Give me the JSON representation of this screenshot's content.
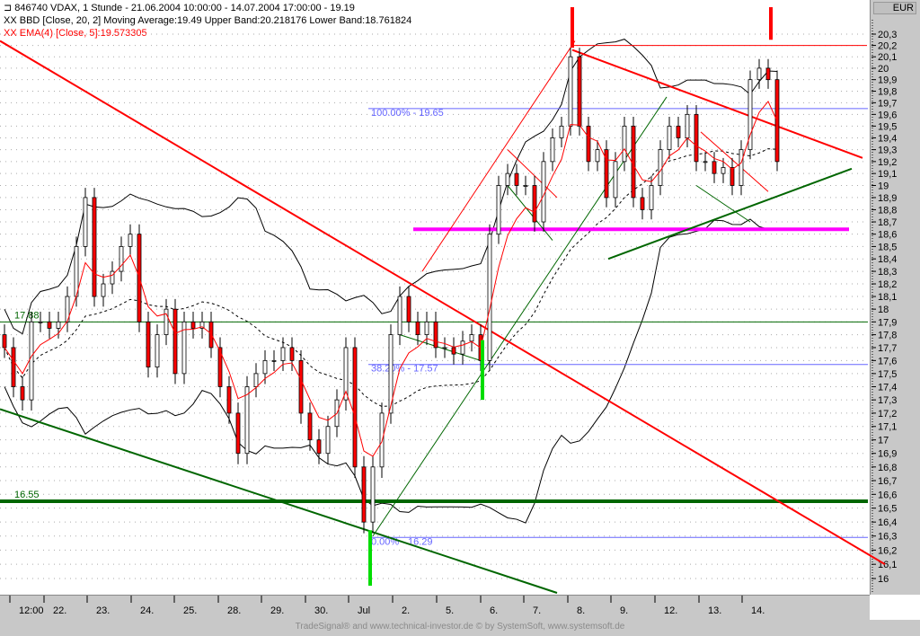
{
  "header": {
    "line1": "846740  VDAX, 1 Stunde - 21.06.2004 10:00:00 - 14.07.2004 17:00:00 - 19.19",
    "line2": "BBD [Close, 20, 2] Moving Average:19.49 Upper Band:20.218176 Lower Band:18.761824",
    "line3": "EMA(4) [Close, 5]:19.573305",
    "prefix": "XX"
  },
  "currency": "EUR",
  "footer": "TradeSignal® and www.technical-investor.de © by SystemSoft, www.systemsoft.de",
  "colors": {
    "up": "#ffffff",
    "down": "#ff0000",
    "ema": "#ff0000",
    "bands": "#000000",
    "magenta": "#ff00ff",
    "fib": "#6666ff",
    "green": "#006600",
    "marker_green": "#00dd00"
  },
  "chart_data": {
    "type": "candlestick",
    "y_scale": "log",
    "ylim": [
      16,
      20.3
    ],
    "y_ticks": [
      "16",
      "16,1",
      "16,2",
      "16,3",
      "16,4",
      "16,5",
      "16,6",
      "16,7",
      "16,8",
      "16,9",
      "17",
      "17,1",
      "17,2",
      "17,3",
      "17,4",
      "17,5",
      "17,6",
      "17,7",
      "17,8",
      "17,9",
      "18",
      "18,1",
      "18,2",
      "18,3",
      "18,4",
      "18,5",
      "18,6",
      "18,7",
      "18,8",
      "18,9",
      "19",
      "19,1",
      "19,2",
      "19,3",
      "19,4",
      "19,5",
      "19,6",
      "19,7",
      "19,8",
      "19,9",
      "20",
      "20,1",
      "20,2",
      "20,3"
    ],
    "x_labels": [
      {
        "label": "12:00",
        "bar": 0.9
      },
      {
        "label": "22.",
        "bar": 4.7
      },
      {
        "label": "23.",
        "bar": 9.5
      },
      {
        "label": "24.",
        "bar": 14.4
      },
      {
        "label": "25.",
        "bar": 19.2
      },
      {
        "label": "28.",
        "bar": 24.1
      },
      {
        "label": "29.",
        "bar": 28.9
      },
      {
        "label": "30.",
        "bar": 33.8
      },
      {
        "label": "Jul",
        "bar": 38.6
      },
      {
        "label": "2.",
        "bar": 43.5
      },
      {
        "label": "5.",
        "bar": 48.4
      },
      {
        "label": "6.",
        "bar": 53.3
      },
      {
        "label": "7.",
        "bar": 58.1
      },
      {
        "label": "8.",
        "bar": 63
      },
      {
        "label": "9.",
        "bar": 67.8
      },
      {
        "label": "12.",
        "bar": 72.7
      },
      {
        "label": "13.",
        "bar": 77.6
      },
      {
        "label": "14.",
        "bar": 82.4
      }
    ],
    "close": [
      17.7,
      17.4,
      17.3,
      17.9,
      17.9,
      17.85,
      17.9,
      18.1,
      18.5,
      18.9,
      18.1,
      18.2,
      18.3,
      18.5,
      18.6,
      17.9,
      17.55,
      17.8,
      18.0,
      17.5,
      17.9,
      17.85,
      17.9,
      17.7,
      17.4,
      17.2,
      16.9,
      17.4,
      17.5,
      17.6,
      17.6,
      17.7,
      17.6,
      17.2,
      17.0,
      16.9,
      17.1,
      17.3,
      17.7,
      16.8,
      16.4,
      16.8,
      17.2,
      17.8,
      18.1,
      17.9,
      17.8,
      17.9,
      17.7,
      17.7,
      17.65,
      17.75,
      17.8,
      17.6,
      18.6,
      19.0,
      19.1,
      19.0,
      19.0,
      18.7,
      19.2,
      19.4,
      19.5,
      20.1,
      19.5,
      19.2,
      19.3,
      18.9,
      19.2,
      19.5,
      18.9,
      18.8,
      19.0,
      19.3,
      19.5,
      19.4,
      19.6,
      19.2,
      19.2,
      19.1,
      19.15,
      19.0,
      19.3,
      19.9,
      20.0,
      19.9,
      19.2
    ],
    "indicators": [
      {
        "name": "BBD",
        "source": "Close",
        "period": 20,
        "deviations": 2,
        "moving_average": 19.49,
        "upper_band": 20.218176,
        "lower_band": 18.761824
      },
      {
        "name": "EMA(4)",
        "source": "Close",
        "period": 5,
        "value": 19.573305
      }
    ],
    "horizontal_levels": [
      {
        "label": "17.88",
        "price": 17.9,
        "color": "#006600",
        "width": 1
      },
      {
        "label": "16.55",
        "price": 16.55,
        "color": "#006600",
        "width": 4
      },
      {
        "label": "100.00% - 19.65",
        "price": 19.65,
        "color": "#6666ff",
        "width": 1,
        "from_bar": 40.5
      },
      {
        "label": "38.20% - 17.57",
        "price": 17.57,
        "color": "#6666ff",
        "width": 1,
        "from_bar": 40.5
      },
      {
        "label": "0.00% - 16.29",
        "price": 16.29,
        "color": "#6666ff",
        "width": 1,
        "from_bar": 40.5
      }
    ],
    "trend_lines": [
      {
        "from": [
          -0.5,
          20.24
        ],
        "to": [
          98,
          16.1
        ],
        "color": "#ff0000",
        "width": 2
      },
      {
        "from": [
          -0.5,
          17.23
        ],
        "to": [
          61.5,
          15.9
        ],
        "color": "#006600",
        "width": 2
      },
      {
        "from": [
          45.5,
          18.64
        ],
        "to": [
          94,
          18.64
        ],
        "color": "#ff00ff",
        "width": 4
      },
      {
        "from": [
          63.2,
          20.2
        ],
        "to": [
          96,
          20.2
        ],
        "color": "#ff0000",
        "width": 1
      },
      {
        "from": [
          63.2,
          20.16
        ],
        "to": [
          95.5,
          19.23
        ],
        "color": "#ff0000",
        "width": 2
      },
      {
        "from": [
          67.2,
          18.4
        ],
        "to": [
          94.3,
          19.14
        ],
        "color": "#006600",
        "width": 2
      },
      {
        "from": [
          46.5,
          18.3
        ],
        "to": [
          63.5,
          20.24
        ],
        "color": "#ff0000",
        "width": 1
      },
      {
        "from": [
          41,
          16.3
        ],
        "to": [
          73.7,
          19.75
        ],
        "color": "#006600",
        "width": 1
      },
      {
        "from": [
          56,
          19.3
        ],
        "to": [
          61.5,
          18.9
        ],
        "color": "#ff0000",
        "width": 1
      },
      {
        "from": [
          56,
          19.0
        ],
        "to": [
          61,
          18.55
        ],
        "color": "#006600",
        "width": 1
      },
      {
        "from": [
          77.5,
          19.45
        ],
        "to": [
          85,
          18.95
        ],
        "color": "#ff0000",
        "width": 1
      },
      {
        "from": [
          77,
          19.0
        ],
        "to": [
          83,
          18.7
        ],
        "color": "#006600",
        "width": 1
      },
      {
        "from": [
          44,
          17.8
        ],
        "to": [
          53,
          17.6
        ],
        "color": "#006600",
        "width": 1
      }
    ],
    "markers": [
      {
        "bar": 63.2,
        "top": 20.3,
        "bottom": 20.18,
        "color": "#ff0000"
      },
      {
        "bar": 85.3,
        "top": 20.3,
        "bottom": 20.25,
        "color": "#ff0000"
      },
      {
        "bar": 40.7,
        "top": 16.15,
        "bottom": 15.95,
        "color": "#00dd00"
      },
      {
        "bar": 53.2,
        "top": 17.55,
        "bottom": 17.3,
        "color": "#00dd00"
      }
    ]
  }
}
